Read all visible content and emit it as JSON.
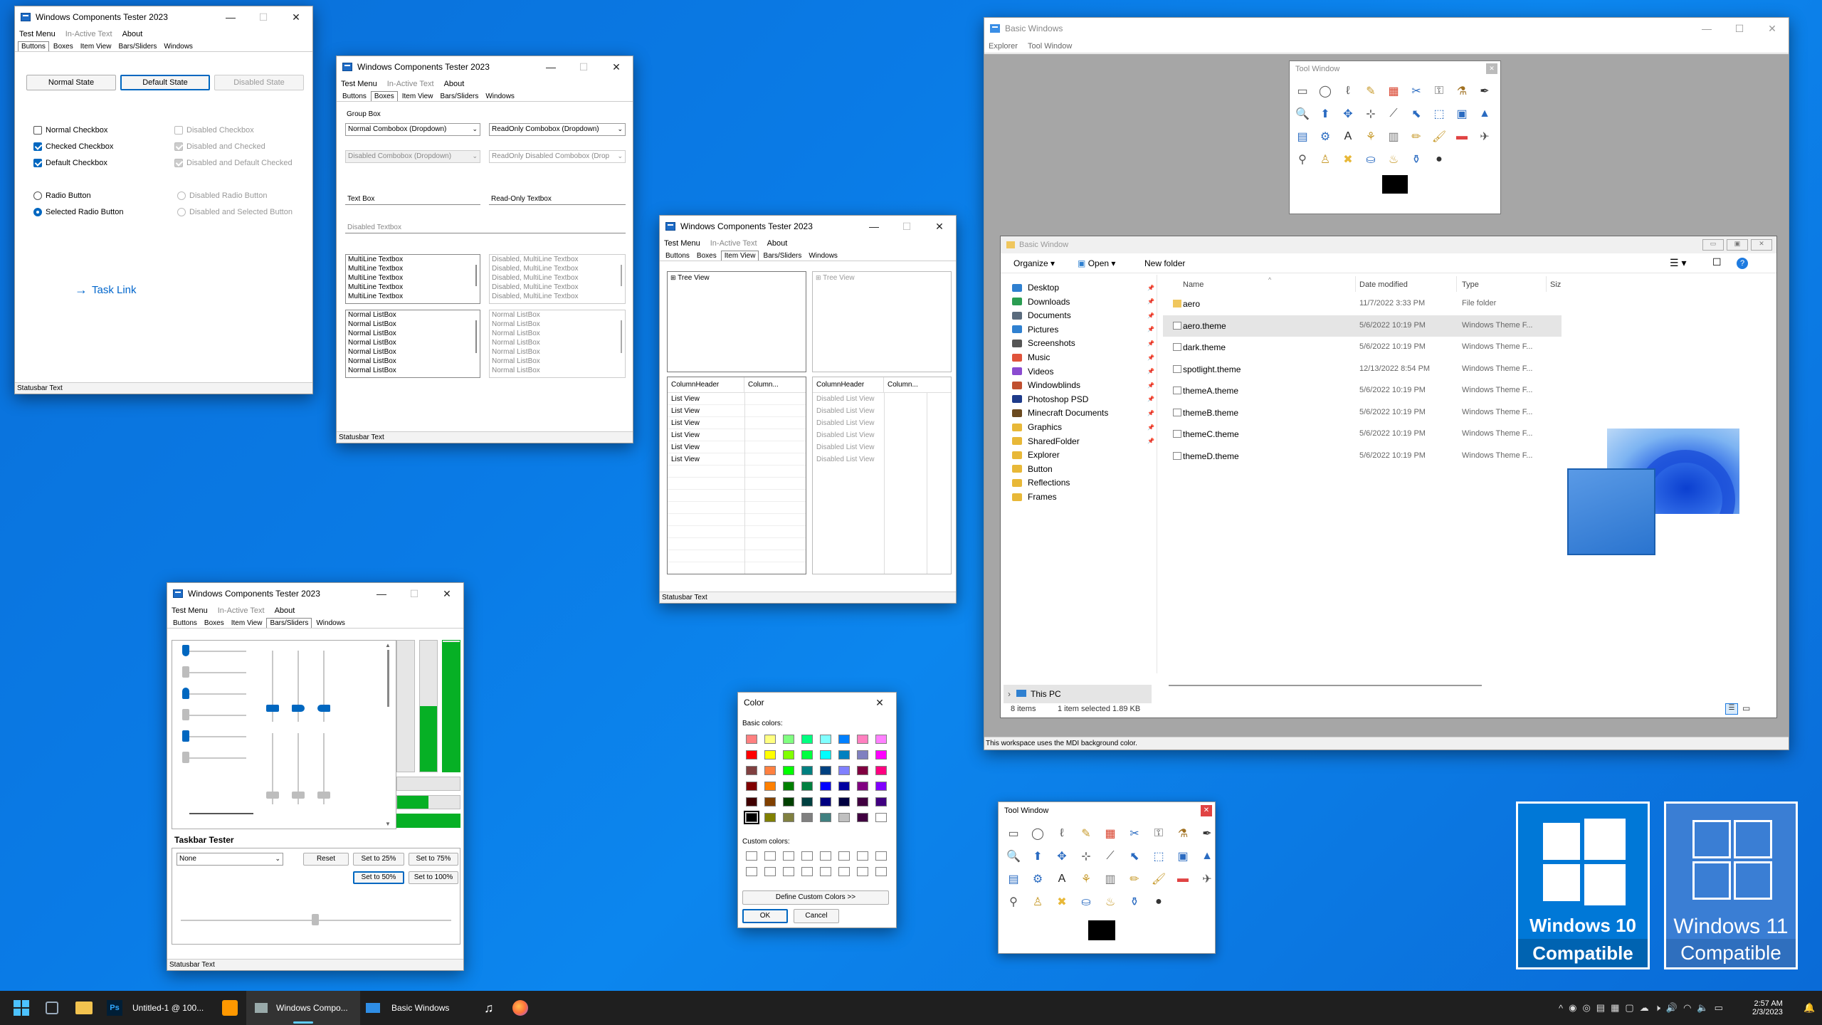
{
  "win1": {
    "title": "Windows Components Tester 2023",
    "menu": [
      "Test Menu",
      "In-Active Text",
      "About"
    ],
    "tabs": [
      "Buttons",
      "Boxes",
      "Item View",
      "Bars/Sliders",
      "Windows"
    ],
    "buttons": {
      "normal": "Normal State",
      "default": "Default State",
      "disabled": "Disabled State"
    },
    "checks": [
      "Normal Checkbox",
      "Checked Checkbox",
      "Default Checkbox",
      "Disabled Checkbox",
      "Disabled and Checked",
      "Disabled and Default Checked"
    ],
    "radios": [
      "Radio Button",
      "Selected Radio Button",
      "Disabled Radio Button",
      "Disabled and Selected Button"
    ],
    "task_link": "Task Link",
    "status": "Statusbar Text"
  },
  "win2": {
    "title": "Windows Components Tester 2023",
    "menu": [
      "Test Menu",
      "In-Active Text",
      "About"
    ],
    "tabs": [
      "Buttons",
      "Boxes",
      "Item View",
      "Bars/Sliders",
      "Windows"
    ],
    "group_label": "Group Box",
    "combo1": "Normal Combobox (Dropdown)",
    "combo2": "ReadOnly Combobox (Dropdown)",
    "combo3": "Disabled Combobox (Dropdown)",
    "combo4": "ReadOnly Disabled Combobox (Drop",
    "textbox": "Text Box",
    "readonly_textbox": "Read-Only Textbox",
    "disabled_textbox": "Disabled Textbox",
    "multiline": [
      "MultiLine Textbox",
      "MultiLine Textbox",
      "MultiLine Textbox",
      "MultiLine Textbox",
      "MultiLine Textbox"
    ],
    "multiline_dis": [
      "Disabled, MultiLine Textbox",
      "Disabled, MultiLine Textbox",
      "Disabled, MultiLine Textbox",
      "Disabled, MultiLine Textbox",
      "Disabled, MultiLine Textbox"
    ],
    "listbox": [
      "Normal ListBox",
      "Normal ListBox",
      "Normal ListBox",
      "Normal ListBox",
      "Normal ListBox",
      "Normal ListBox",
      "Normal ListBox"
    ],
    "status": "Statusbar Text"
  },
  "win3": {
    "title": "Windows Components Tester 2023",
    "menu": [
      "Test Menu",
      "In-Active Text",
      "About"
    ],
    "tabs": [
      "Buttons",
      "Boxes",
      "Item View",
      "Bars/Sliders",
      "Windows"
    ],
    "tree": "Tree View",
    "col1": "ColumnHeader",
    "col2": "Column...",
    "list": [
      "List View",
      "List View",
      "List View",
      "List View",
      "List View",
      "List View"
    ],
    "list_dis": [
      "Disabled List View",
      "Disabled List View",
      "Disabled List View",
      "Disabled List View",
      "Disabled List View",
      "Disabled List View"
    ],
    "status": "Statusbar Text"
  },
  "win4": {
    "title": "Windows Components Tester 2023",
    "menu": [
      "Test Menu",
      "In-Active Text",
      "About"
    ],
    "tabs": [
      "Buttons",
      "Boxes",
      "Item View",
      "Bars/Sliders",
      "Windows"
    ],
    "taskbar_tester": "Taskbar Tester",
    "combo": "None",
    "reset": "Reset",
    "set25": "Set to 25%",
    "set75": "Set to 75%",
    "set50": "Set to 50%",
    "set100": "Set to 100%",
    "progress_levels": [
      0.0,
      0.5,
      0.97
    ],
    "status": "Statusbar Text"
  },
  "color": {
    "title": "Color",
    "basic": "Basic colors:",
    "custom": "Custom colors:",
    "define": "Define Custom Colors >>",
    "ok": "OK",
    "cancel": "Cancel",
    "swatches": [
      "#ff8080",
      "#ffff80",
      "#80ff80",
      "#00ff80",
      "#80ffff",
      "#0080ff",
      "#ff80c0",
      "#ff80ff",
      "#ff0000",
      "#ffff00",
      "#80ff00",
      "#00ff40",
      "#00ffff",
      "#0080c0",
      "#8080c0",
      "#ff00ff",
      "#804040",
      "#ff8040",
      "#00ff00",
      "#008080",
      "#004080",
      "#8080ff",
      "#800040",
      "#ff0080",
      "#800000",
      "#ff8000",
      "#008000",
      "#008040",
      "#0000ff",
      "#0000a0",
      "#800080",
      "#8000ff",
      "#400000",
      "#804000",
      "#004000",
      "#004040",
      "#000080",
      "#000040",
      "#400040",
      "#400080",
      "#000000",
      "#808000",
      "#808040",
      "#808080",
      "#408080",
      "#c0c0c0",
      "#400040",
      "#ffffff"
    ]
  },
  "toolwin": {
    "title": "Tool Window",
    "icons": [
      "▭",
      "◯",
      "ℓ",
      "✎",
      "▦",
      "✂",
      "⚿",
      "⚗",
      "✒",
      "🔍",
      "⬆",
      "✥",
      "⊹",
      "⟋",
      "⬉",
      "⬚",
      "▣",
      "▲",
      "▤",
      "⚙",
      "A",
      "⚘",
      "▥",
      "✏",
      "🖌",
      "▬",
      "✈",
      "⚲",
      "♙",
      "✖",
      "⛀",
      "♨",
      "⚱",
      "●"
    ]
  },
  "basic": {
    "title": "Basic Windows",
    "menu": [
      "Explorer",
      "Tool Window"
    ],
    "status": "This workspace uses the MDI background color.",
    "inner": {
      "title": "Basic Window",
      "organize": "Organize",
      "open": "Open",
      "new_folder": "New folder",
      "sidebar": [
        {
          "label": "Desktop",
          "color": "#2f80d0"
        },
        {
          "label": "Downloads",
          "color": "#2a9d52"
        },
        {
          "label": "Documents",
          "color": "#5a6b7d"
        },
        {
          "label": "Pictures",
          "color": "#2f80d0"
        },
        {
          "label": "Screenshots",
          "color": "#555555"
        },
        {
          "label": "Music",
          "color": "#e0533b"
        },
        {
          "label": "Videos",
          "color": "#8a4bd0"
        },
        {
          "label": "Windowblinds",
          "color": "#c05030"
        },
        {
          "label": "Photoshop PSD",
          "color": "#1e3b8a"
        },
        {
          "label": "Minecraft Documents",
          "color": "#6b4a20"
        },
        {
          "label": "Graphics",
          "color": "#e8b838"
        },
        {
          "label": "SharedFolder",
          "color": "#e8b838"
        },
        {
          "label": "Explorer",
          "color": "#e8b838"
        },
        {
          "label": "Button",
          "color": "#e8b838"
        },
        {
          "label": "Reflections",
          "color": "#e8b838"
        },
        {
          "label": "Frames",
          "color": "#e8b838"
        }
      ],
      "this_pc": "This PC",
      "cols": [
        "Name",
        "Date modified",
        "Type",
        "Siz"
      ],
      "files": [
        {
          "name": "aero",
          "date": "11/7/2022 3:33 PM",
          "type": "File folder"
        },
        {
          "name": "aero.theme",
          "date": "5/6/2022 10:19 PM",
          "type": "Windows Theme F..."
        },
        {
          "name": "dark.theme",
          "date": "5/6/2022 10:19 PM",
          "type": "Windows Theme F..."
        },
        {
          "name": "spotlight.theme",
          "date": "12/13/2022 8:54 PM",
          "type": "Windows Theme F..."
        },
        {
          "name": "themeA.theme",
          "date": "5/6/2022 10:19 PM",
          "type": "Windows Theme F..."
        },
        {
          "name": "themeB.theme",
          "date": "5/6/2022 10:19 PM",
          "type": "Windows Theme F..."
        },
        {
          "name": "themeC.theme",
          "date": "5/6/2022 10:19 PM",
          "type": "Windows Theme F..."
        },
        {
          "name": "themeD.theme",
          "date": "5/6/2022 10:19 PM",
          "type": "Windows Theme F..."
        }
      ],
      "items": "8 items",
      "selected": "1 item selected  1.89 KB"
    }
  },
  "badges": {
    "w10": {
      "brand": "Windows 10",
      "sub": "Compatible"
    },
    "w11": {
      "brand": "Windows 11",
      "sub": "Compatible"
    }
  },
  "taskbar": {
    "ps": "Untitled-1 @ 100...",
    "wct": "Windows Compo...",
    "bw": "Basic Windows",
    "time": "2:57 AM",
    "date": "2/3/2023"
  }
}
